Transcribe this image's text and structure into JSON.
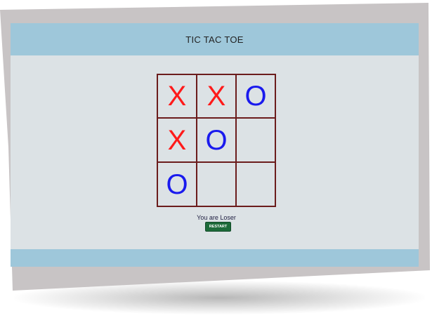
{
  "game": {
    "title": "TIC TAC TOE",
    "board": [
      [
        "X",
        "X",
        "O"
      ],
      [
        "X",
        "O",
        ""
      ],
      [
        "O",
        "",
        ""
      ]
    ],
    "status": "You are Loser",
    "restart_label": "RESTART"
  },
  "colors": {
    "x_mark": "#ff1a1a",
    "o_mark": "#1a1aee",
    "header_bar": "#9ec7da",
    "board_lines": "#6b1c1c",
    "restart_button": "#1d6b3a",
    "screen_bg": "#dce2e5"
  }
}
